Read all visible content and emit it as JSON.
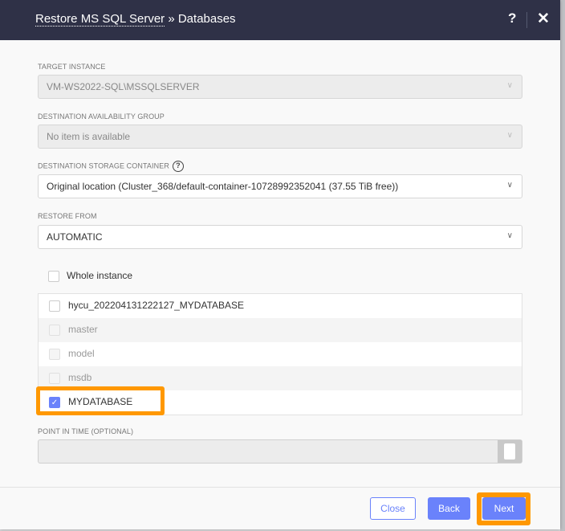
{
  "dialog": {
    "title_crumb": "Restore MS SQL Server",
    "title_rest": " » Databases",
    "help": "?",
    "close": "✕"
  },
  "fields": {
    "target_instance": {
      "label": "TARGET INSTANCE",
      "value": "VM-WS2022-SQL\\MSSQLSERVER"
    },
    "availability_group": {
      "label": "DESTINATION AVAILABILITY GROUP",
      "value": "No item is available"
    },
    "storage_container": {
      "label": "DESTINATION STORAGE CONTAINER",
      "value": "Original location (Cluster_368/default-container-10728992352041 (37.55 TiB free))",
      "help": "?"
    },
    "restore_from": {
      "label": "RESTORE FROM",
      "value": "AUTOMATIC"
    },
    "point_in_time": {
      "label": "POINT IN TIME (OPTIONAL)",
      "value": ""
    }
  },
  "whole_instance": {
    "label": "Whole instance",
    "checked": false
  },
  "databases": [
    {
      "name": "hycu_202204131222127_MYDATABASE",
      "checked": false,
      "disabled": false
    },
    {
      "name": "master",
      "checked": false,
      "disabled": true
    },
    {
      "name": "model",
      "checked": false,
      "disabled": true
    },
    {
      "name": "msdb",
      "checked": false,
      "disabled": true
    },
    {
      "name": "MYDATABASE",
      "checked": true,
      "disabled": false
    }
  ],
  "buttons": {
    "close": "Close",
    "back": "Back",
    "next": "Next"
  },
  "colors": {
    "header": "#2f3147",
    "accent": "#6a82fb",
    "highlight": "#ff9800"
  }
}
